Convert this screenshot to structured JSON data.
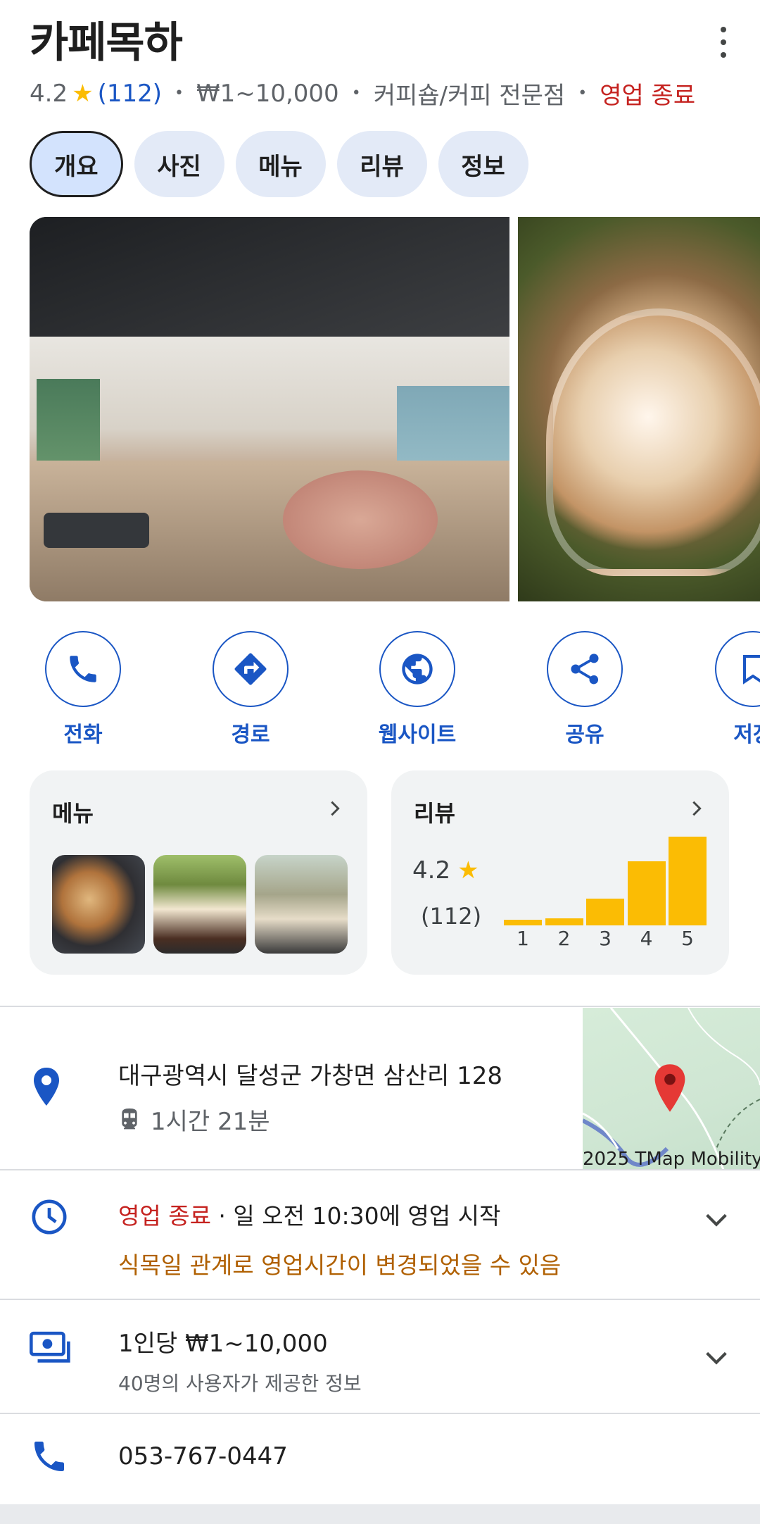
{
  "place": {
    "name": "카페목하",
    "rating": "4.2",
    "review_count": "(112)",
    "price": "₩1~10,000",
    "category": "커피숍/커피 전문점",
    "status": "영업 종료"
  },
  "tabs": [
    {
      "label": "개요",
      "active": true
    },
    {
      "label": "사진",
      "active": false
    },
    {
      "label": "메뉴",
      "active": false
    },
    {
      "label": "리뷰",
      "active": false
    },
    {
      "label": "정보",
      "active": false
    }
  ],
  "actions": [
    {
      "label": "전화",
      "icon": "phone-icon"
    },
    {
      "label": "경로",
      "icon": "directions-icon"
    },
    {
      "label": "웹사이트",
      "icon": "globe-icon"
    },
    {
      "label": "공유",
      "icon": "share-icon"
    },
    {
      "label": "저장",
      "icon": "bookmark-icon"
    }
  ],
  "menu_card": {
    "title": "메뉴"
  },
  "review_card": {
    "title": "리뷰",
    "rating": "4.2",
    "count": "(112)"
  },
  "chart_data": {
    "type": "bar",
    "categories": [
      "1",
      "2",
      "3",
      "4",
      "5"
    ],
    "values": [
      0.06,
      0.08,
      0.3,
      0.72,
      1.0
    ],
    "ylim": [
      0,
      1
    ]
  },
  "address": {
    "text": "대구광역시 달성군 가창면 삼산리 128",
    "transit": "1시간 21분",
    "map_credit": "2025 TMap Mobility"
  },
  "hours": {
    "status": "영업 종료",
    "detail": " · 일 오전 10:30에 영업 시작",
    "note": "식목일 관계로 영업시간이 변경되었을 수 있음"
  },
  "price_info": {
    "line": "1인당 ₩1~10,000",
    "note": "40명의 사용자가 제공한 정보"
  },
  "phone": {
    "number": "053-767-0447"
  },
  "colors": {
    "accent": "#1a56c4",
    "closed": "#c5221f",
    "warning": "#b06000",
    "star": "#fbbc04"
  }
}
